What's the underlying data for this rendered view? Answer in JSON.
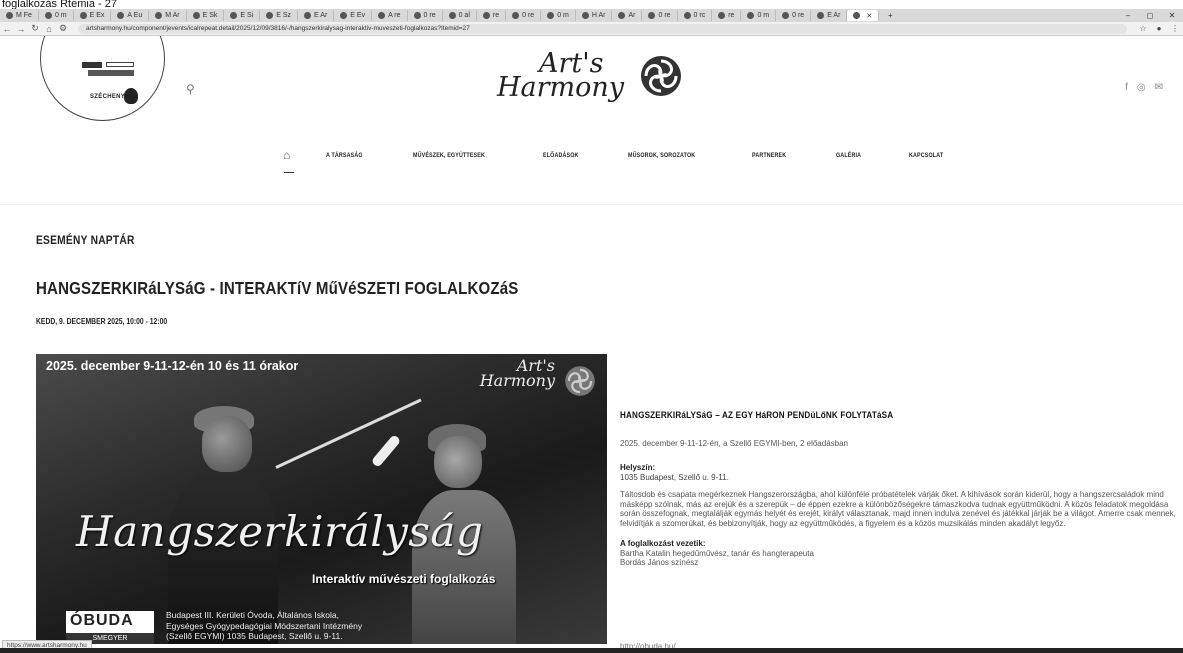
{
  "caption": "foglalkozás Rtemia - 27",
  "browser": {
    "tabs": [
      "M Fe",
      "0 m",
      "E Ex",
      "A Eu",
      "M Ar",
      "E Sk",
      "E Si",
      "E Sz",
      "E Ar",
      "E Ev",
      "A re",
      "0 re",
      "0 al",
      "re",
      "0 re",
      "0 m",
      "H Ar",
      "Ar",
      "0 re",
      "0 rc",
      "re",
      "0 m",
      "0 re",
      "E Ar"
    ],
    "active_tab": "",
    "url": "artsharmony.hu/component/jevents/icalrepeat.detail/2025/12/09/3816/-/hangszerkiralysag-interaktiv-muveszeti-foglalkozas?Itemid=27",
    "new_tab": "+",
    "minimize": "–",
    "maximize": "◻",
    "close": "✕"
  },
  "header": {
    "brand_line1": "Art's",
    "brand_line2": "Harmony",
    "logo_szechenyi": "SZÉCHENYI"
  },
  "nav": {
    "items": [
      "A TÁRSASÁG",
      "MŰVÉSZEK, EGYÜTTESEK",
      "ELŐADÁSOK",
      "MŰSOROK, SOROZATOK",
      "PARTNEREK",
      "GALÉRIA",
      "KAPCSOLAT"
    ]
  },
  "content": {
    "section_title": "ESEMÉNY NAPTÁR",
    "event_title": "HANGSZERKIRáLYSáG - INTERAKTíV MűVéSZETI FOGLALKOZáS",
    "event_date": "KEDD, 9. DECEMBER 2025, 10:00 - 12:00"
  },
  "poster": {
    "date": "2025. december 9-11-12-én 10 és 11 órakor",
    "brand_line1": "Art's",
    "brand_line2": "Harmony",
    "script_title": "Hangszerkirályság",
    "subtitle": "Interaktív művészeti foglalkozás",
    "obuda": "ÓBUDA",
    "obuda_sub": "SMEGYER",
    "venue_line1": "Budapest III. Kerületi Óvoda, Általános Iskola,",
    "venue_line2": "Egységes Gyógypedagógiai Módszertani Intézmény",
    "venue_line3": "(Szellő EGYMI) 1035 Budapest, Szellő u. 9-11."
  },
  "description": {
    "title": "HANGSZERKIRáLYSáG – AZ EGY HáRON PENDüLőNK FOLYTATáSA",
    "intro": "2025. december 9-11-12-én, a Szellő EGYMI-ben, 2 előadásban",
    "location_label": "Helyszín:",
    "location": "1035 Budapest, Szellő u. 9-11.",
    "body": "Táltosdob és csapata megérkeznek Hangszerországba, ahol különféle próbatételek várják őket. A kihívások során kiderül, hogy a hangszercsaládok mind másképp szólnak, más az erejük és a szerepük – de éppen ezekre a különbözőségekre támaszkodva tudnak együttműködni. A közös feladatok megoldása során összefognak, megtalálják egymás helyét és erejét, királyt választanak, majd innen indulva zenével és játékkal járják be a világot. Amerre csak mennek, felvidítják a szomorúkat, és bebizonyítják, hogy az együttműködés, a figyelem és a közös muzsikálás minden akadályt legyőz.",
    "leaders_label": "A foglalkozást vezetik:",
    "leader1": "Bartha Katalin hegedűművész, tanár és hangterapeuta",
    "leader2": "Bordás János színész",
    "link": "http://obuda.hu/"
  },
  "status_url": "https://www.artsharmony.hu"
}
